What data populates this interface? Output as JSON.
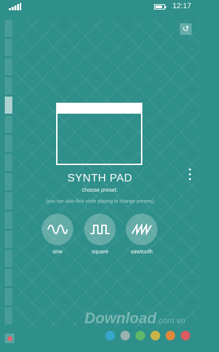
{
  "status_bar": {
    "time": "12:17",
    "signal_icon": "signal-bars-icon",
    "battery_icon": "battery-icon"
  },
  "app": {
    "title": "SYNTH PAD",
    "subtitle": "choose preset:",
    "hint": "(you can also flick while playing to change presets)"
  },
  "presets": [
    {
      "label": "sine",
      "icon": "sine-wave-icon"
    },
    {
      "label": "square",
      "icon": "square-wave-icon"
    },
    {
      "label": "sawtooth",
      "icon": "sawtooth-wave-icon"
    }
  ],
  "keyboard": {
    "key_count": 16,
    "active_key": 4
  },
  "watermark": {
    "text": "Download",
    "suffix": ".com.vn"
  },
  "color_dots": [
    "#36a7c9",
    "#9ab3b0",
    "#5fb86a",
    "#c9b44a",
    "#e0893c",
    "#d95d62"
  ],
  "colors": {
    "background": "#2f8f8a",
    "accent": "#ffffff",
    "record": "#e8606a"
  }
}
